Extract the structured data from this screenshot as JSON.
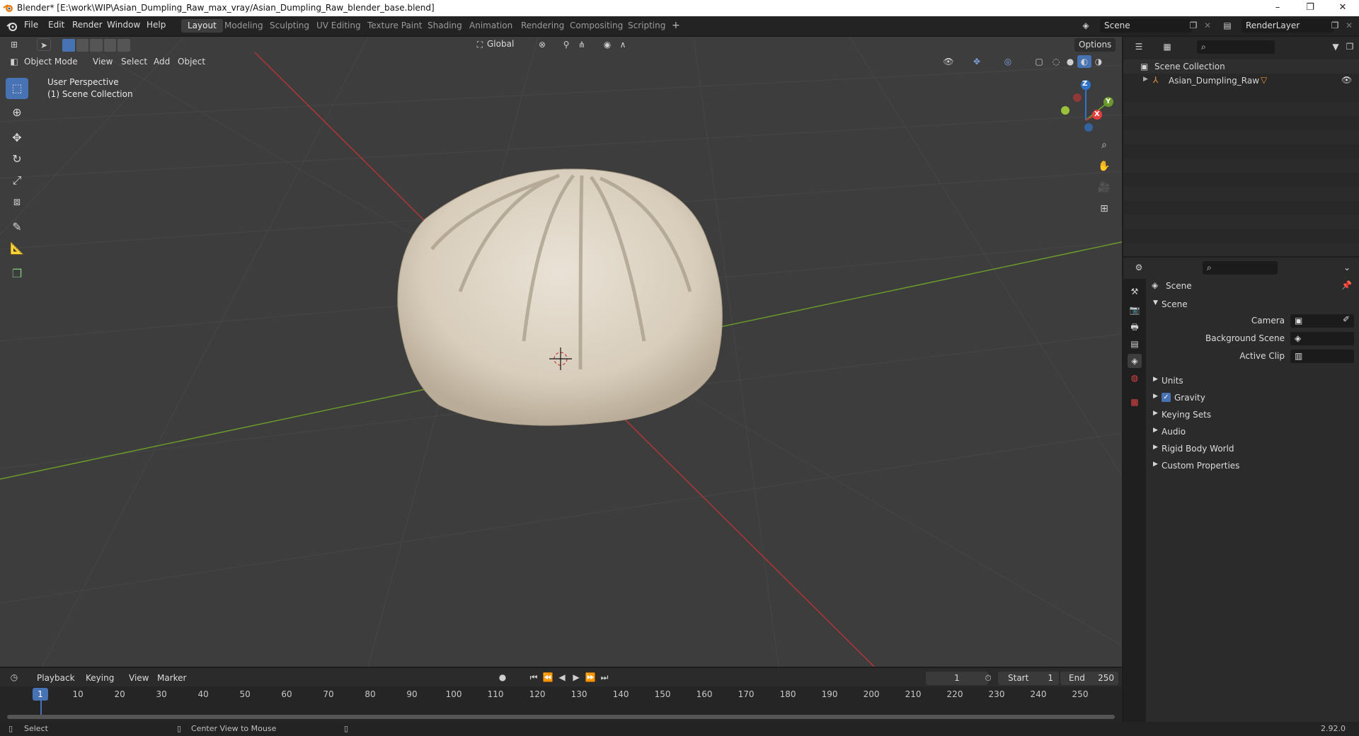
{
  "window": {
    "title": "Blender* [E:\\work\\WIP\\Asian_Dumpling_Raw_max_vray/Asian_Dumpling_Raw_blender_base.blend]",
    "controls": [
      "–",
      "❐",
      "✕"
    ]
  },
  "menu": [
    "File",
    "Edit",
    "Render",
    "Window",
    "Help"
  ],
  "workspaces": {
    "active": "Layout",
    "tabs": [
      "Layout",
      "Modeling",
      "Sculpting",
      "UV Editing",
      "Texture Paint",
      "Shading",
      "Animation",
      "Rendering",
      "Compositing",
      "Scripting"
    ],
    "add": "+"
  },
  "scene_selector": {
    "value": "Scene"
  },
  "renderlayer_selector": {
    "value": "RenderLayer"
  },
  "viewport_header": {
    "mode": "Object Mode",
    "menus": [
      "View",
      "Select",
      "Add",
      "Object"
    ],
    "orientation": "Global",
    "options": "Options"
  },
  "viewport": {
    "perspective": "User Perspective",
    "collection": "(1) Scene Collection",
    "gizmo": {
      "z": "Z",
      "y": "Y",
      "x": "X"
    }
  },
  "outliner": {
    "root": "Scene Collection",
    "items": [
      {
        "label": "Asian_Dumpling_Raw"
      }
    ]
  },
  "properties": {
    "context": "Scene",
    "panel": "Scene",
    "fields": [
      {
        "label": "Camera",
        "value": ""
      },
      {
        "label": "Background Scene",
        "value": ""
      },
      {
        "label": "Active Clip",
        "value": ""
      }
    ],
    "sections": [
      "Units",
      "Gravity",
      "Keying Sets",
      "Audio",
      "Rigid Body World",
      "Custom Properties"
    ],
    "gravity_checked": true
  },
  "timeline": {
    "menus": [
      "Playback",
      "Keying",
      "View",
      "Marker"
    ],
    "current_frame": "1",
    "start_label": "Start",
    "start": "1",
    "end_label": "End",
    "end": "250",
    "ticks": [
      "1",
      "10",
      "20",
      "30",
      "40",
      "50",
      "60",
      "70",
      "80",
      "90",
      "100",
      "110",
      "120",
      "130",
      "140",
      "150",
      "160",
      "170",
      "180",
      "190",
      "200",
      "210",
      "220",
      "230",
      "240",
      "250"
    ]
  },
  "status": {
    "select": "Select",
    "center": "Center View to Mouse",
    "version": "2.92.0"
  },
  "colors": {
    "accent": "#4772b3",
    "x_axis": "#b13636",
    "y_axis": "#6a9a2a",
    "z_axis": "#2f73c9",
    "frame_indicator": "#4772b3"
  }
}
